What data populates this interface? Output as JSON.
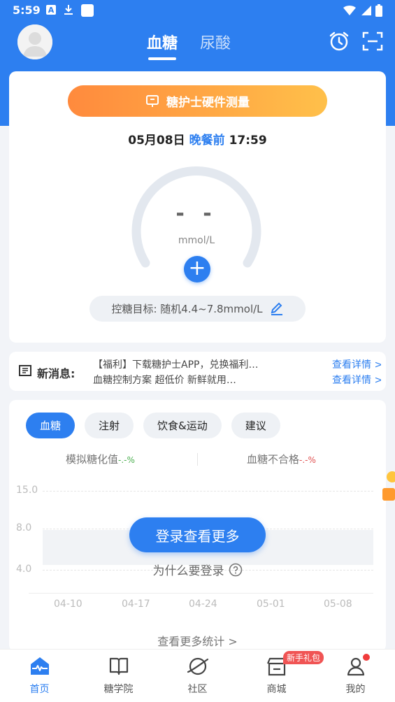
{
  "status_bar": {
    "time": "5:59"
  },
  "header": {
    "tabs": [
      {
        "label": "血糖",
        "active": true
      },
      {
        "label": "尿酸",
        "active": false
      }
    ]
  },
  "main_card": {
    "hardware_button": "糖护士硬件测量",
    "date": "05月08日",
    "meal": "晚餐前",
    "time": "17:59",
    "gauge_value": "- -",
    "gauge_unit": "mmol/L",
    "target": "控糖目标: 随机4.4~7.8mmol/L"
  },
  "message": {
    "label": "新消息:",
    "lines": [
      "【福利】下载糖护士APP，兑换福利…",
      "血糖控制方案 超低价 新鲜就用…"
    ],
    "link": "查看详情 >"
  },
  "stats": {
    "chips": [
      {
        "label": "血糖",
        "active": true
      },
      {
        "label": "注射",
        "active": false
      },
      {
        "label": "饮食&运动",
        "active": false
      },
      {
        "label": "建议",
        "active": false
      }
    ],
    "metric_left_label": "模拟糖化值",
    "metric_left_value": "-.-%",
    "metric_right_label": "血糖不合格",
    "metric_right_value": "-.-%",
    "login_button": "登录查看更多",
    "why_login": "为什么要登录",
    "more_stats": "查看更多统计 >"
  },
  "chart_data": {
    "type": "line",
    "y_ticks": [
      "15.0",
      "8.0",
      "4.0"
    ],
    "x_ticks": [
      "04-10",
      "04-17",
      "04-24",
      "05-01",
      "05-08"
    ],
    "target_band": [
      4.4,
      7.8
    ],
    "ylim": [
      0,
      15
    ],
    "series": []
  },
  "bottom_nav": [
    {
      "label": "首页",
      "icon": "home-pulse-icon",
      "active": true
    },
    {
      "label": "糖学院",
      "icon": "book-icon",
      "active": false
    },
    {
      "label": "社区",
      "icon": "planet-icon",
      "active": false
    },
    {
      "label": "商城",
      "icon": "shop-icon",
      "active": false,
      "badge": "新手礼包"
    },
    {
      "label": "我的",
      "icon": "person-icon",
      "active": false
    }
  ],
  "colors": {
    "primary": "#2d7ff0",
    "accent_orange": "#ff8a3d",
    "badge_red": "#f05454"
  }
}
